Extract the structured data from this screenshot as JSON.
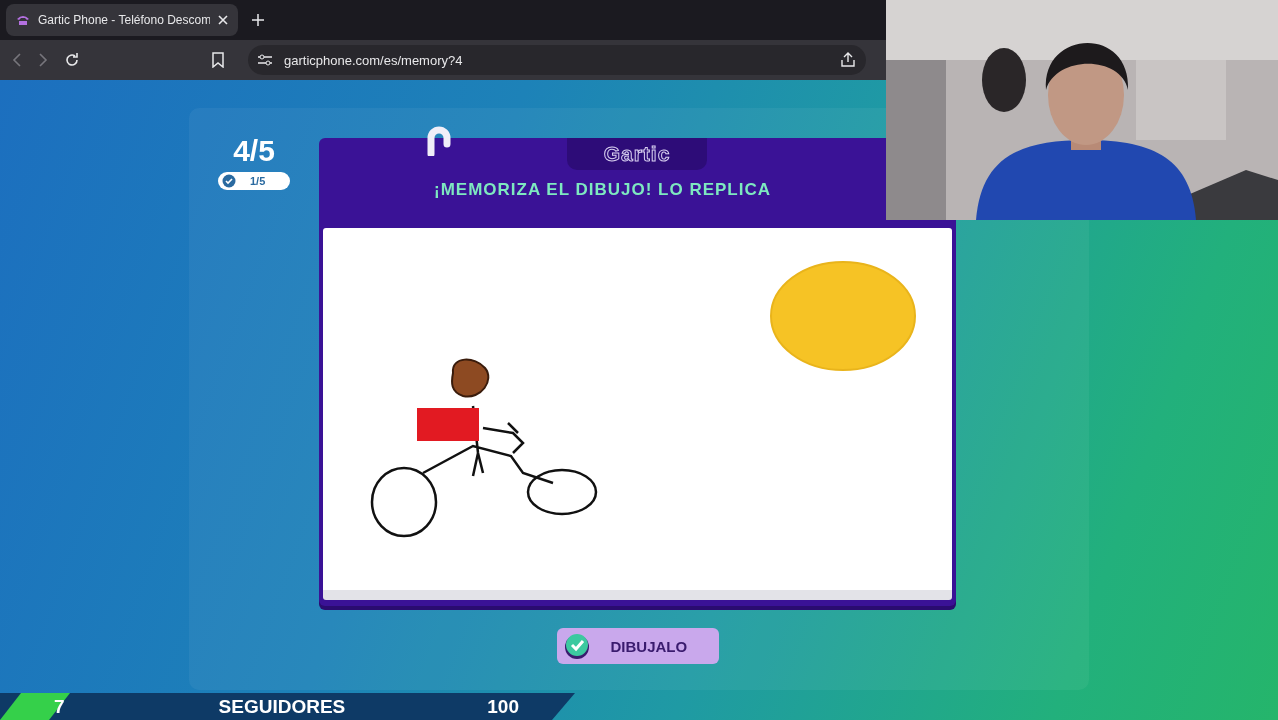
{
  "browser": {
    "tab": {
      "title": "Gartic Phone - Teléfono Descom"
    },
    "address": "garticphone.com/es/memory?4"
  },
  "round": {
    "counter": "4/5",
    "badge": "1/5"
  },
  "card": {
    "logo": "Gartic",
    "instruction": "¡MEMORIZA EL DIBUJO! LO REPLICA"
  },
  "done_button": {
    "label": "DIBUJALO"
  },
  "followers": {
    "count": "7",
    "label": "SEGUIDORES",
    "goal": "100",
    "level": 0.07
  }
}
